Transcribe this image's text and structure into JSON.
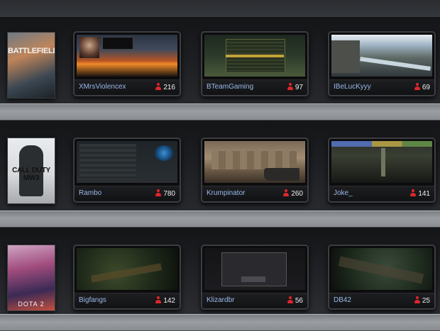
{
  "games": [
    {
      "cover_title": "BATTLEFIELD",
      "streams": [
        {
          "streamer": "XMrsViolencex",
          "viewers": "216"
        },
        {
          "streamer": "BTeamGaming",
          "viewers": "97"
        },
        {
          "streamer": "IBeLucKyyy",
          "viewers": "69"
        }
      ]
    },
    {
      "cover_title": "CALL DUTY MW3",
      "streams": [
        {
          "streamer": "Rambo",
          "viewers": "780"
        },
        {
          "streamer": "Krumpinator",
          "viewers": "260"
        },
        {
          "streamer": "Joke_",
          "viewers": "141"
        }
      ]
    },
    {
      "cover_title": "DOTA 2",
      "streams": [
        {
          "streamer": "Bigfangs",
          "viewers": "142"
        },
        {
          "streamer": "Klizardbr",
          "viewers": "56"
        },
        {
          "streamer": "DB42",
          "viewers": "25"
        }
      ]
    }
  ],
  "colors": {
    "streamer_name": "#9ab8ea",
    "viewer_icon": "#e0262a",
    "shelf": "#9a9da1"
  },
  "icons": {
    "viewers": "person-icon"
  }
}
